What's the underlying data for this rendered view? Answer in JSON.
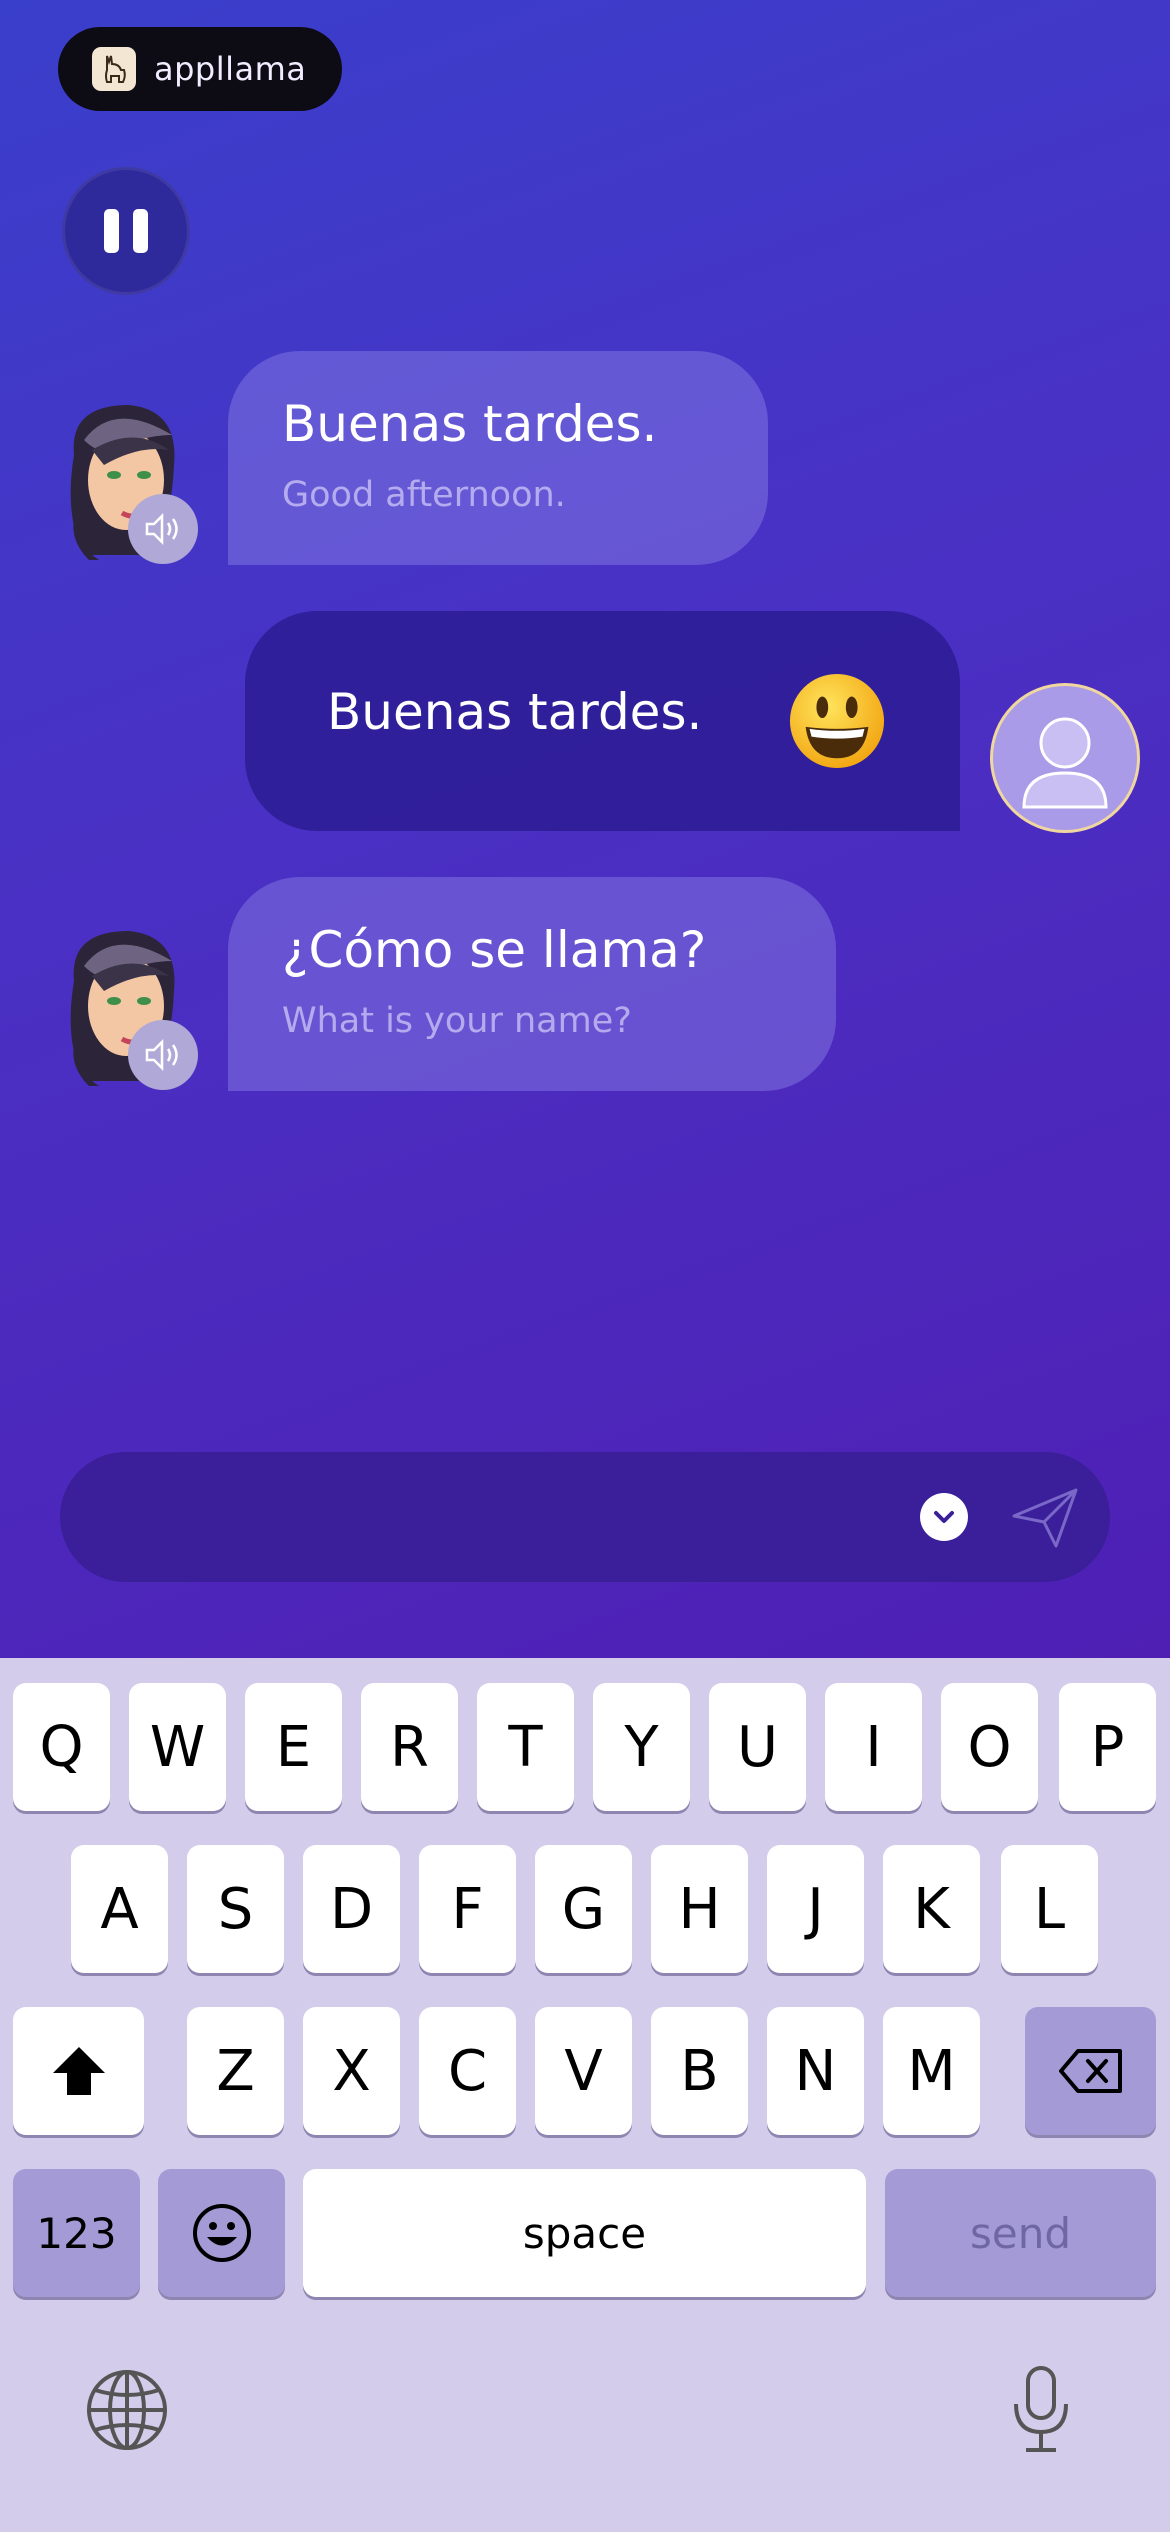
{
  "brand": {
    "name": "appllama",
    "logo_icon": "llama-icon"
  },
  "controls": {
    "pause_icon": "pause-icon"
  },
  "messages": [
    {
      "role": "bot",
      "text": "Buenas tardes.",
      "translation": "Good afternoon."
    },
    {
      "role": "user",
      "text": "Buenas tardes.",
      "emoji": "grinning-face-emoji"
    },
    {
      "role": "bot",
      "text": "¿Cómo se llama?",
      "translation": "What is your name?"
    }
  ],
  "input": {
    "placeholder": "",
    "chevron_icon": "chevron-down-icon",
    "send_icon": "paper-plane-icon"
  },
  "keyboard": {
    "row1": [
      "Q",
      "W",
      "E",
      "R",
      "T",
      "Y",
      "U",
      "I",
      "O",
      "P"
    ],
    "row2": [
      "A",
      "S",
      "D",
      "F",
      "G",
      "H",
      "J",
      "K",
      "L"
    ],
    "row3": [
      "Z",
      "X",
      "C",
      "V",
      "B",
      "N",
      "M"
    ],
    "numbers_label": "123",
    "space_label": "space",
    "send_label": "send"
  },
  "colors": {
    "accent": "#4a30c4",
    "bubble_user": "#2f1f95",
    "keyboard_bg": "#d3ccea"
  }
}
